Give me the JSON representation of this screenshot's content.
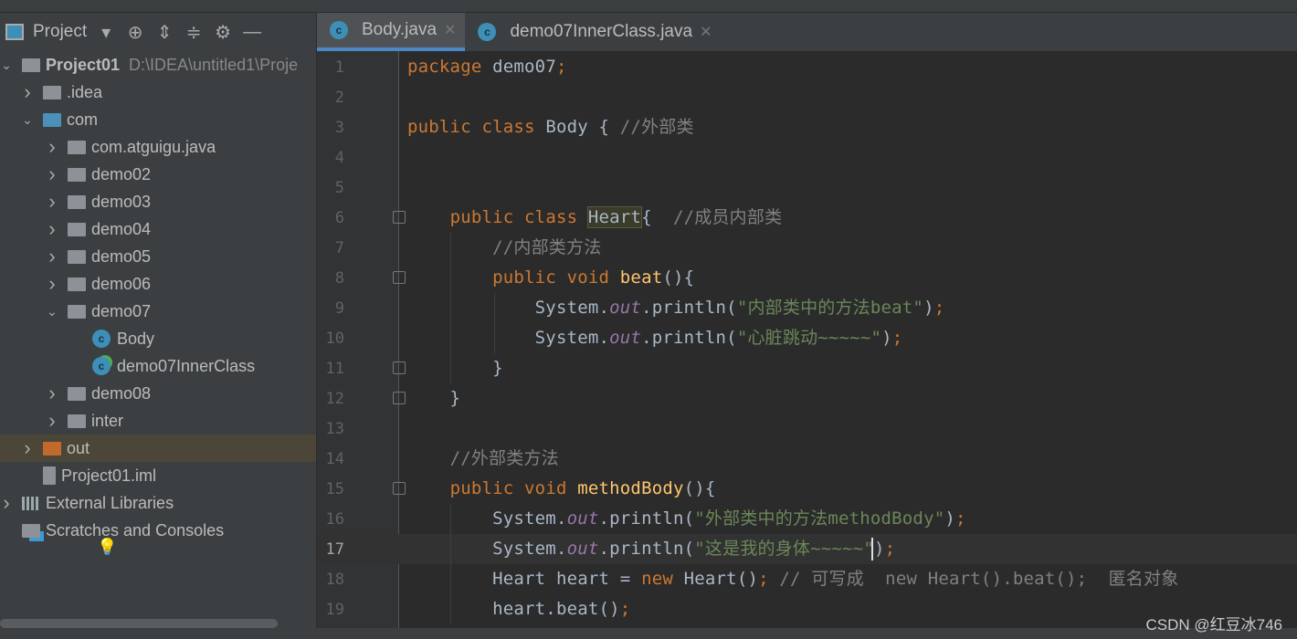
{
  "sidebar": {
    "title": "Project",
    "tree": [
      {
        "label": "Project01",
        "path": "D:\\IDEA\\untitled1\\Proje",
        "depth": 0,
        "arrow": "v",
        "icon": "project-icon",
        "bold": true
      },
      {
        "label": ".idea",
        "depth": 1,
        "arrow": ">",
        "icon": "folder"
      },
      {
        "label": "com",
        "depth": 1,
        "arrow": "v",
        "icon": "folder-blue"
      },
      {
        "label": "com.atguigu.java",
        "depth": 2,
        "arrow": ">",
        "icon": "package"
      },
      {
        "label": "demo02",
        "depth": 2,
        "arrow": ">",
        "icon": "package"
      },
      {
        "label": "demo03",
        "depth": 2,
        "arrow": ">",
        "icon": "package"
      },
      {
        "label": "demo04",
        "depth": 2,
        "arrow": ">",
        "icon": "package"
      },
      {
        "label": "demo05",
        "depth": 2,
        "arrow": ">",
        "icon": "package"
      },
      {
        "label": "demo06",
        "depth": 2,
        "arrow": ">",
        "icon": "package"
      },
      {
        "label": "demo07",
        "depth": 2,
        "arrow": "v",
        "icon": "package"
      },
      {
        "label": "Body",
        "depth": 3,
        "arrow": "",
        "icon": "class"
      },
      {
        "label": "demo07InnerClass",
        "depth": 3,
        "arrow": "",
        "icon": "class-run"
      },
      {
        "label": "demo08",
        "depth": 2,
        "arrow": ">",
        "icon": "package"
      },
      {
        "label": "inter",
        "depth": 2,
        "arrow": ">",
        "icon": "package"
      },
      {
        "label": "out",
        "depth": 1,
        "arrow": ">",
        "icon": "folder-orange",
        "selected": true
      },
      {
        "label": "Project01.iml",
        "depth": 1,
        "arrow": "",
        "icon": "file"
      },
      {
        "label": "External Libraries",
        "depth": 0,
        "arrow": ">",
        "icon": "libraries"
      },
      {
        "label": "Scratches and Consoles",
        "depth": 0,
        "arrow": "",
        "icon": "scratches"
      }
    ]
  },
  "tabs": [
    {
      "label": "Body.java",
      "active": true
    },
    {
      "label": "demo07InnerClass.java",
      "active": false
    }
  ],
  "editor": {
    "current_line": 17,
    "lines": [
      [
        [
          "kw",
          "package "
        ],
        [
          "",
          "demo07"
        ],
        [
          "kw",
          ";"
        ]
      ],
      [],
      [
        [
          "kw",
          "public class "
        ],
        [
          "",
          "Body { "
        ],
        [
          "cm",
          "//外部类"
        ]
      ],
      [],
      [],
      [
        [
          "",
          "    "
        ],
        [
          "kw",
          "public class "
        ],
        [
          "hl",
          "Heart"
        ],
        [
          "",
          "{  "
        ],
        [
          "cm",
          "//成员内部类"
        ]
      ],
      [
        [
          "",
          "        "
        ],
        [
          "cm",
          "//内部类方法"
        ]
      ],
      [
        [
          "",
          "        "
        ],
        [
          "kw",
          "public void "
        ],
        [
          "fn",
          "beat"
        ],
        [
          "",
          "(){"
        ]
      ],
      [
        [
          "",
          "            System."
        ],
        [
          "out",
          "out"
        ],
        [
          "",
          ".println("
        ],
        [
          "str",
          "\"内部类中的方法beat\""
        ],
        [
          "",
          ")"
        ],
        [
          "kw",
          ";"
        ]
      ],
      [
        [
          "",
          "            System."
        ],
        [
          "out",
          "out"
        ],
        [
          "",
          ".println("
        ],
        [
          "str",
          "\"心脏跳动~~~~~\""
        ],
        [
          "",
          ")"
        ],
        [
          "kw",
          ";"
        ]
      ],
      [
        [
          "",
          "        }"
        ]
      ],
      [
        [
          "",
          "    }"
        ]
      ],
      [],
      [
        [
          "",
          "    "
        ],
        [
          "cm",
          "//外部类方法"
        ]
      ],
      [
        [
          "",
          "    "
        ],
        [
          "kw",
          "public void "
        ],
        [
          "fn",
          "methodBody"
        ],
        [
          "",
          "(){"
        ]
      ],
      [
        [
          "",
          "        System."
        ],
        [
          "out",
          "out"
        ],
        [
          "",
          ".println("
        ],
        [
          "str",
          "\"外部类中的方法methodBody\""
        ],
        [
          "",
          ")"
        ],
        [
          "kw",
          ";"
        ]
      ],
      [
        [
          "",
          "        System."
        ],
        [
          "out",
          "out"
        ],
        [
          "",
          ".println("
        ],
        [
          "str",
          "\"这是我的身体~~~~~\""
        ],
        [
          "",
          ")"
        ],
        [
          "kw",
          ";"
        ]
      ],
      [
        [
          "",
          "        Heart heart = "
        ],
        [
          "kw",
          "new "
        ],
        [
          "",
          "Heart()"
        ],
        [
          "kw",
          ";"
        ],
        [
          "cm",
          " // 可写成  new Heart().beat();  匿名对象"
        ]
      ],
      [
        [
          "",
          "        heart.beat()"
        ],
        [
          "kw",
          ";"
        ]
      ]
    ]
  },
  "watermark": "CSDN @红豆冰746"
}
